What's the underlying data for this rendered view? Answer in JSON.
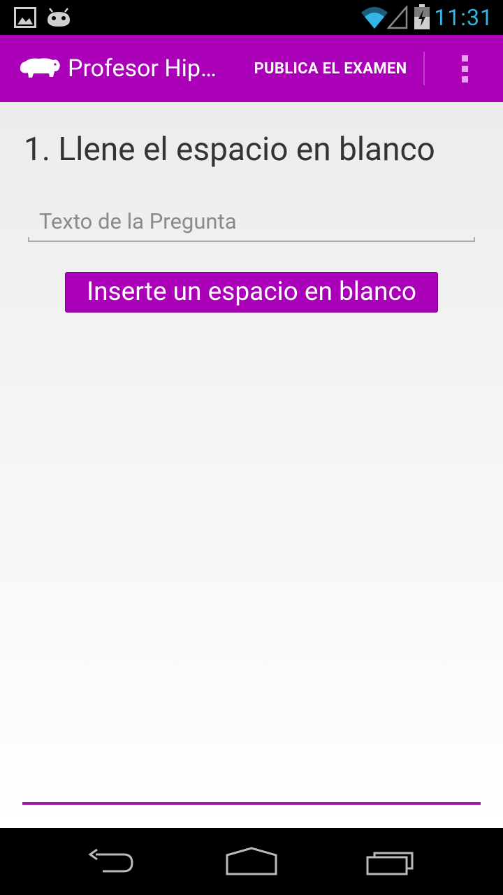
{
  "status_bar": {
    "time": "11:31",
    "icons": [
      "picture-icon",
      "android-icon",
      "wifi-icon",
      "signal-icon",
      "battery-charging-icon"
    ],
    "clock_color": "#33b5e5"
  },
  "action_bar": {
    "app_title": "Profesor Hip…",
    "publish_label": "PUBLICA EL EXAMEN",
    "icons": [
      "hippo-icon",
      "overflow-menu-icon"
    ],
    "color": "#aa00b8"
  },
  "content": {
    "question_title": "1. Llene el espacio en blanco",
    "question_input": {
      "value": "",
      "placeholder": "Texto de la Pregunta"
    },
    "insert_button_label": "Inserte un espacio en blanco"
  },
  "nav_bar": {
    "icons": [
      "back-icon",
      "home-icon",
      "recents-icon"
    ]
  }
}
